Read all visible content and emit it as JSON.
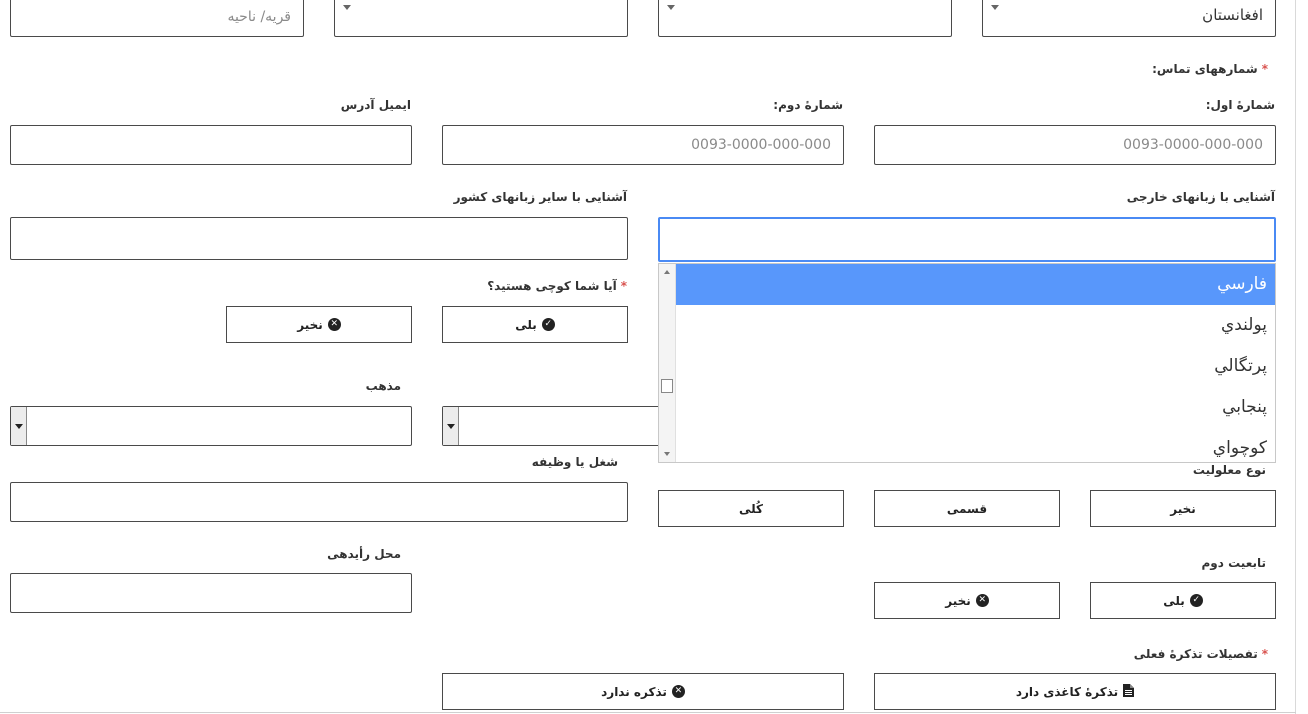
{
  "address": {
    "country_value": "افغانستان",
    "village_placeholder": "قریه/ ناحیه"
  },
  "contacts": {
    "title": "شمارههای تماس:",
    "first_label": "شمارهٔ اول:",
    "second_label": "شمارهٔ دوم:",
    "email_label": "ایمیل آدرس",
    "first_placeholder": "0093-0000-000-000",
    "second_placeholder": "0093-0000-000-000"
  },
  "languages": {
    "foreign_label": "آشنایی با زبانهای خارجی",
    "local_label": "آشنایی با سایر زبانهای کشور",
    "options": [
      "فارسي",
      "پولندي",
      "پرتگالي",
      "پنجابي",
      "کوچواي"
    ]
  },
  "nomad": {
    "question": "آیا شما کوچی هستید؟",
    "yes": "بلی",
    "no": "نخیر"
  },
  "religion": {
    "label": "مذهب"
  },
  "occupation": {
    "label": "شغل یا وظیفه"
  },
  "disability": {
    "label": "نوع معلولیت",
    "none": "نخیر",
    "partial": "قسمی",
    "full": "کُلی"
  },
  "voting": {
    "label": "محل رأیدهی"
  },
  "second_citizenship": {
    "label": "تابعیت دوم",
    "yes": "بلی",
    "no": "نخیر"
  },
  "tazkira": {
    "label": "تفصیلات تذکرهٔ فعلی",
    "paper": "تذکرهٔ کاغذی دارد",
    "none": "تذکره ندارد"
  }
}
